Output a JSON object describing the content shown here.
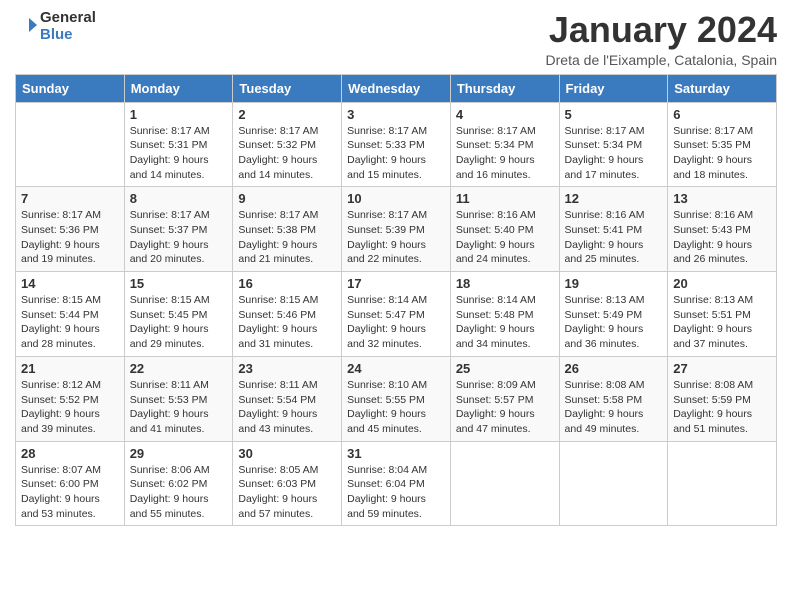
{
  "logo": {
    "text_general": "General",
    "text_blue": "Blue"
  },
  "title": "January 2024",
  "subtitle": "Dreta de l'Eixample, Catalonia, Spain",
  "days_of_week": [
    "Sunday",
    "Monday",
    "Tuesday",
    "Wednesday",
    "Thursday",
    "Friday",
    "Saturday"
  ],
  "weeks": [
    [
      {
        "day": "",
        "info": ""
      },
      {
        "day": "1",
        "info": "Sunrise: 8:17 AM\nSunset: 5:31 PM\nDaylight: 9 hours\nand 14 minutes."
      },
      {
        "day": "2",
        "info": "Sunrise: 8:17 AM\nSunset: 5:32 PM\nDaylight: 9 hours\nand 14 minutes."
      },
      {
        "day": "3",
        "info": "Sunrise: 8:17 AM\nSunset: 5:33 PM\nDaylight: 9 hours\nand 15 minutes."
      },
      {
        "day": "4",
        "info": "Sunrise: 8:17 AM\nSunset: 5:34 PM\nDaylight: 9 hours\nand 16 minutes."
      },
      {
        "day": "5",
        "info": "Sunrise: 8:17 AM\nSunset: 5:34 PM\nDaylight: 9 hours\nand 17 minutes."
      },
      {
        "day": "6",
        "info": "Sunrise: 8:17 AM\nSunset: 5:35 PM\nDaylight: 9 hours\nand 18 minutes."
      }
    ],
    [
      {
        "day": "7",
        "info": "Sunrise: 8:17 AM\nSunset: 5:36 PM\nDaylight: 9 hours\nand 19 minutes."
      },
      {
        "day": "8",
        "info": "Sunrise: 8:17 AM\nSunset: 5:37 PM\nDaylight: 9 hours\nand 20 minutes."
      },
      {
        "day": "9",
        "info": "Sunrise: 8:17 AM\nSunset: 5:38 PM\nDaylight: 9 hours\nand 21 minutes."
      },
      {
        "day": "10",
        "info": "Sunrise: 8:17 AM\nSunset: 5:39 PM\nDaylight: 9 hours\nand 22 minutes."
      },
      {
        "day": "11",
        "info": "Sunrise: 8:16 AM\nSunset: 5:40 PM\nDaylight: 9 hours\nand 24 minutes."
      },
      {
        "day": "12",
        "info": "Sunrise: 8:16 AM\nSunset: 5:41 PM\nDaylight: 9 hours\nand 25 minutes."
      },
      {
        "day": "13",
        "info": "Sunrise: 8:16 AM\nSunset: 5:43 PM\nDaylight: 9 hours\nand 26 minutes."
      }
    ],
    [
      {
        "day": "14",
        "info": "Sunrise: 8:15 AM\nSunset: 5:44 PM\nDaylight: 9 hours\nand 28 minutes."
      },
      {
        "day": "15",
        "info": "Sunrise: 8:15 AM\nSunset: 5:45 PM\nDaylight: 9 hours\nand 29 minutes."
      },
      {
        "day": "16",
        "info": "Sunrise: 8:15 AM\nSunset: 5:46 PM\nDaylight: 9 hours\nand 31 minutes."
      },
      {
        "day": "17",
        "info": "Sunrise: 8:14 AM\nSunset: 5:47 PM\nDaylight: 9 hours\nand 32 minutes."
      },
      {
        "day": "18",
        "info": "Sunrise: 8:14 AM\nSunset: 5:48 PM\nDaylight: 9 hours\nand 34 minutes."
      },
      {
        "day": "19",
        "info": "Sunrise: 8:13 AM\nSunset: 5:49 PM\nDaylight: 9 hours\nand 36 minutes."
      },
      {
        "day": "20",
        "info": "Sunrise: 8:13 AM\nSunset: 5:51 PM\nDaylight: 9 hours\nand 37 minutes."
      }
    ],
    [
      {
        "day": "21",
        "info": "Sunrise: 8:12 AM\nSunset: 5:52 PM\nDaylight: 9 hours\nand 39 minutes."
      },
      {
        "day": "22",
        "info": "Sunrise: 8:11 AM\nSunset: 5:53 PM\nDaylight: 9 hours\nand 41 minutes."
      },
      {
        "day": "23",
        "info": "Sunrise: 8:11 AM\nSunset: 5:54 PM\nDaylight: 9 hours\nand 43 minutes."
      },
      {
        "day": "24",
        "info": "Sunrise: 8:10 AM\nSunset: 5:55 PM\nDaylight: 9 hours\nand 45 minutes."
      },
      {
        "day": "25",
        "info": "Sunrise: 8:09 AM\nSunset: 5:57 PM\nDaylight: 9 hours\nand 47 minutes."
      },
      {
        "day": "26",
        "info": "Sunrise: 8:08 AM\nSunset: 5:58 PM\nDaylight: 9 hours\nand 49 minutes."
      },
      {
        "day": "27",
        "info": "Sunrise: 8:08 AM\nSunset: 5:59 PM\nDaylight: 9 hours\nand 51 minutes."
      }
    ],
    [
      {
        "day": "28",
        "info": "Sunrise: 8:07 AM\nSunset: 6:00 PM\nDaylight: 9 hours\nand 53 minutes."
      },
      {
        "day": "29",
        "info": "Sunrise: 8:06 AM\nSunset: 6:02 PM\nDaylight: 9 hours\nand 55 minutes."
      },
      {
        "day": "30",
        "info": "Sunrise: 8:05 AM\nSunset: 6:03 PM\nDaylight: 9 hours\nand 57 minutes."
      },
      {
        "day": "31",
        "info": "Sunrise: 8:04 AM\nSunset: 6:04 PM\nDaylight: 9 hours\nand 59 minutes."
      },
      {
        "day": "",
        "info": ""
      },
      {
        "day": "",
        "info": ""
      },
      {
        "day": "",
        "info": ""
      }
    ]
  ]
}
